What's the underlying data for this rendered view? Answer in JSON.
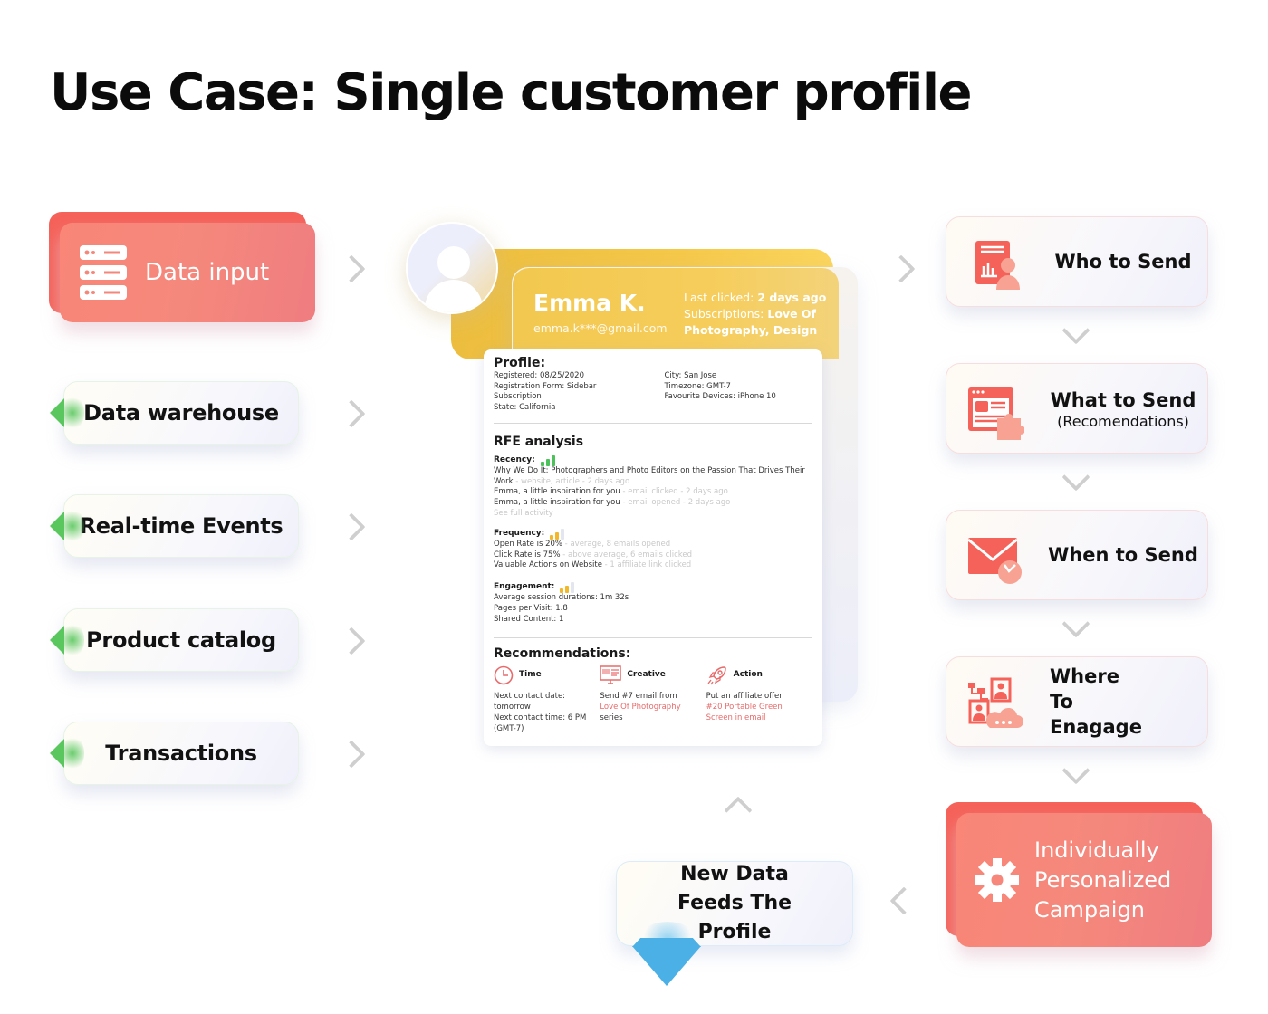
{
  "title": "Use Case: Single customer profile",
  "colors": {
    "accent_red": "#f5625a",
    "accent_yellow": "#f5c84a",
    "accent_green": "#5ac75e",
    "accent_blue": "#4ab0e6"
  },
  "sources": [
    {
      "label": "Data input",
      "icon": "server-stack-icon",
      "highlight": true
    },
    {
      "label": "Data warehouse"
    },
    {
      "label": "Real-time Events"
    },
    {
      "label": "Product catalog"
    },
    {
      "label": "Transactions"
    }
  ],
  "profile": {
    "name": "Emma K.",
    "email": "emma.k***@gmail.com",
    "last_clicked_label": "Last clicked:",
    "last_clicked_value": "2 days ago",
    "subscriptions_label": "Subscriptions:",
    "subscriptions_value": "Love Of Photography, Design",
    "section_profile": "Profile:",
    "details_left": [
      "Registered: 08/25/2020",
      "Registration Form: Sidebar Subscription",
      "State: California"
    ],
    "details_right": [
      "City: San Jose",
      "Timezone: GMT-7",
      "Favourite Devices: iPhone 10"
    ],
    "rfe_title": "RFE analysis",
    "recency": {
      "label": "Recency:",
      "score": 3,
      "max": 3,
      "items": [
        {
          "text": "Why We Do It: Photographers and Photo Editors on the Passion That Drives Their Work",
          "meta": " - website, article - 2 days ago"
        },
        {
          "text": "Emma, a little inspiration for you",
          "meta": " - email clicked - 2 days ago"
        },
        {
          "text": "Emma, a little inspiration for you",
          "meta": " - email opened - 2 days ago"
        }
      ],
      "see_all": "See full activity"
    },
    "frequency": {
      "label": "Frequency:",
      "score": 2,
      "max": 3,
      "items": [
        {
          "text": "Open Rate is 20%",
          "meta": " - average, 8 emails opened"
        },
        {
          "text": "Click Rate is 75%",
          "meta": " - above average, 6 emails clicked"
        },
        {
          "text": "Valuable Actions on Website",
          "meta": " - 1 affiliate link clicked"
        }
      ]
    },
    "engagement": {
      "label": "Engagement:",
      "score": 2,
      "max": 3,
      "items": [
        "Average session durations: 1m 32s",
        "Pages per Visit: 1.8",
        "Shared Content: 1"
      ]
    },
    "recommendations_title": "Recommendations:",
    "recommendations": [
      {
        "title": "Time",
        "icon": "clock-icon",
        "lines": [
          "Next contact date: tomorrow",
          "Next contact time: 6 PM",
          "(GMT-7)"
        ],
        "highlight": []
      },
      {
        "title": "Creative",
        "icon": "monitor-icon",
        "lines": [
          "Send #7 email from"
        ],
        "highlight": [
          "Love Of Photography"
        ],
        "tail": "series"
      },
      {
        "title": "Action",
        "icon": "rocket-icon",
        "lines": [
          "Put an affiliate offer"
        ],
        "highlight": [
          "#20 Portable Green",
          "Screen in email"
        ]
      }
    ]
  },
  "steps": [
    {
      "title": "Who to Send",
      "subtitle": "",
      "icon": "report-person-icon"
    },
    {
      "title": "What to Send",
      "subtitle": "(Recomendations)",
      "icon": "content-puzzle-icon"
    },
    {
      "title": "When to Send",
      "subtitle": "",
      "icon": "mail-clock-icon"
    },
    {
      "title": "Where To Enagage",
      "subtitle": "",
      "icon": "channels-cloud-icon"
    }
  ],
  "campaign": {
    "label": "Individually Personalized Campaign",
    "icon": "gear-icon"
  },
  "feedback": {
    "label": "New Data Feeds The Profile"
  }
}
